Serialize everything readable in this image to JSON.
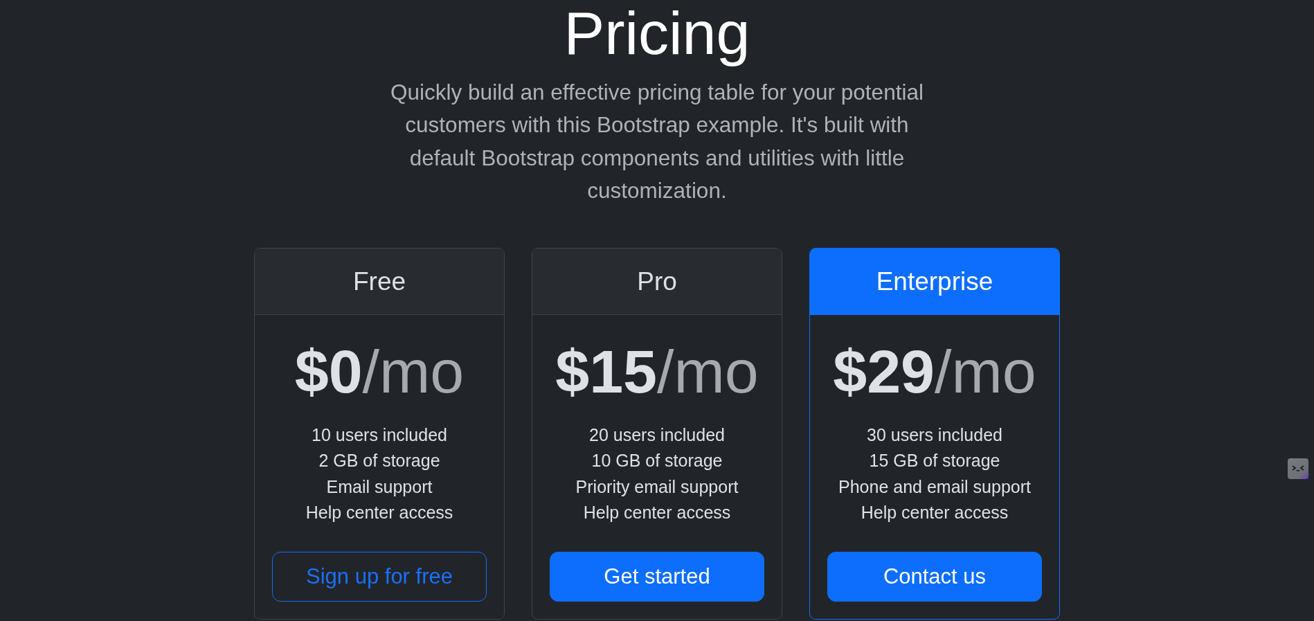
{
  "header": {
    "title": "Pricing",
    "lead": "Quickly build an effective pricing table for your potential customers with this Bootstrap example. It's built with default Bootstrap components and utilities with little customization."
  },
  "plans": [
    {
      "name": "Free",
      "featured": false,
      "price": "**$0**/mo",
      "features": [
        "10 users included",
        "2 GB of storage",
        "Email support",
        "Help center access"
      ],
      "button": {
        "label": "Sign up for free",
        "kind": "outline"
      }
    },
    {
      "name": "Pro",
      "featured": false,
      "price": "**$15**/mo",
      "features": [
        "20 users included",
        "10 GB of storage",
        "Priority email support",
        "Help center access"
      ],
      "button": {
        "label": "Get started",
        "kind": "solid"
      }
    },
    {
      "name": "Enterprise",
      "featured": true,
      "price": "**$29**/mo",
      "features": [
        "30 users included",
        "15 GB of storage",
        "Phone and email support",
        "Help center access"
      ],
      "button": {
        "label": "Contact us",
        "kind": "solid"
      }
    }
  ]
}
